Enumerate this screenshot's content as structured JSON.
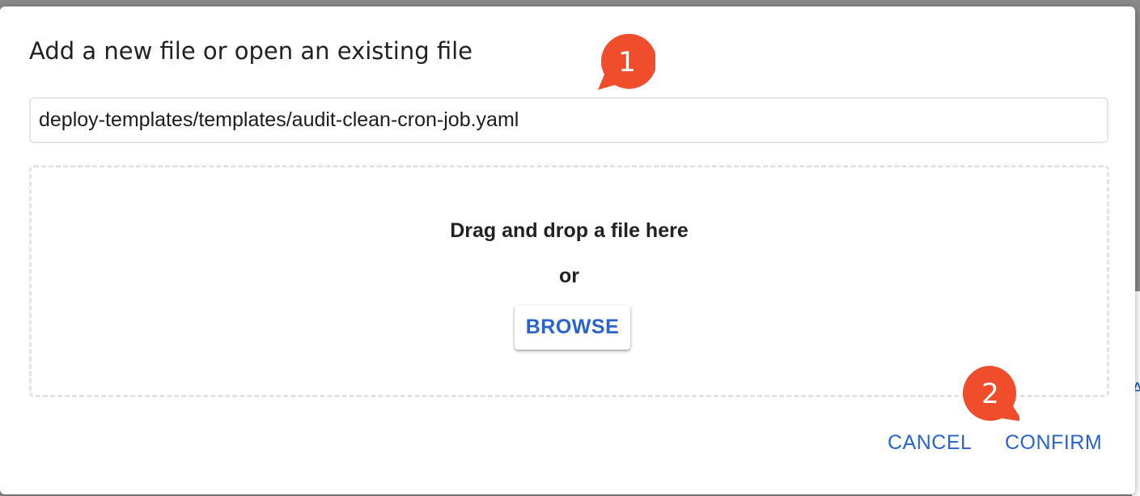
{
  "dialog": {
    "title": "Add a new file or open an existing file",
    "path_value": "deploy-templates/templates/audit-clean-cron-job.yaml",
    "dropzone": {
      "title": "Drag and drop a file here",
      "or_label": "or",
      "browse_label": "BROWSE"
    },
    "actions": {
      "cancel_label": "CANCEL",
      "confirm_label": "CONFIRM"
    }
  },
  "callouts": [
    {
      "label": "1"
    },
    {
      "label": "2"
    }
  ],
  "colors": {
    "accent": "#2a64c9",
    "callout": "#f04d2d"
  }
}
